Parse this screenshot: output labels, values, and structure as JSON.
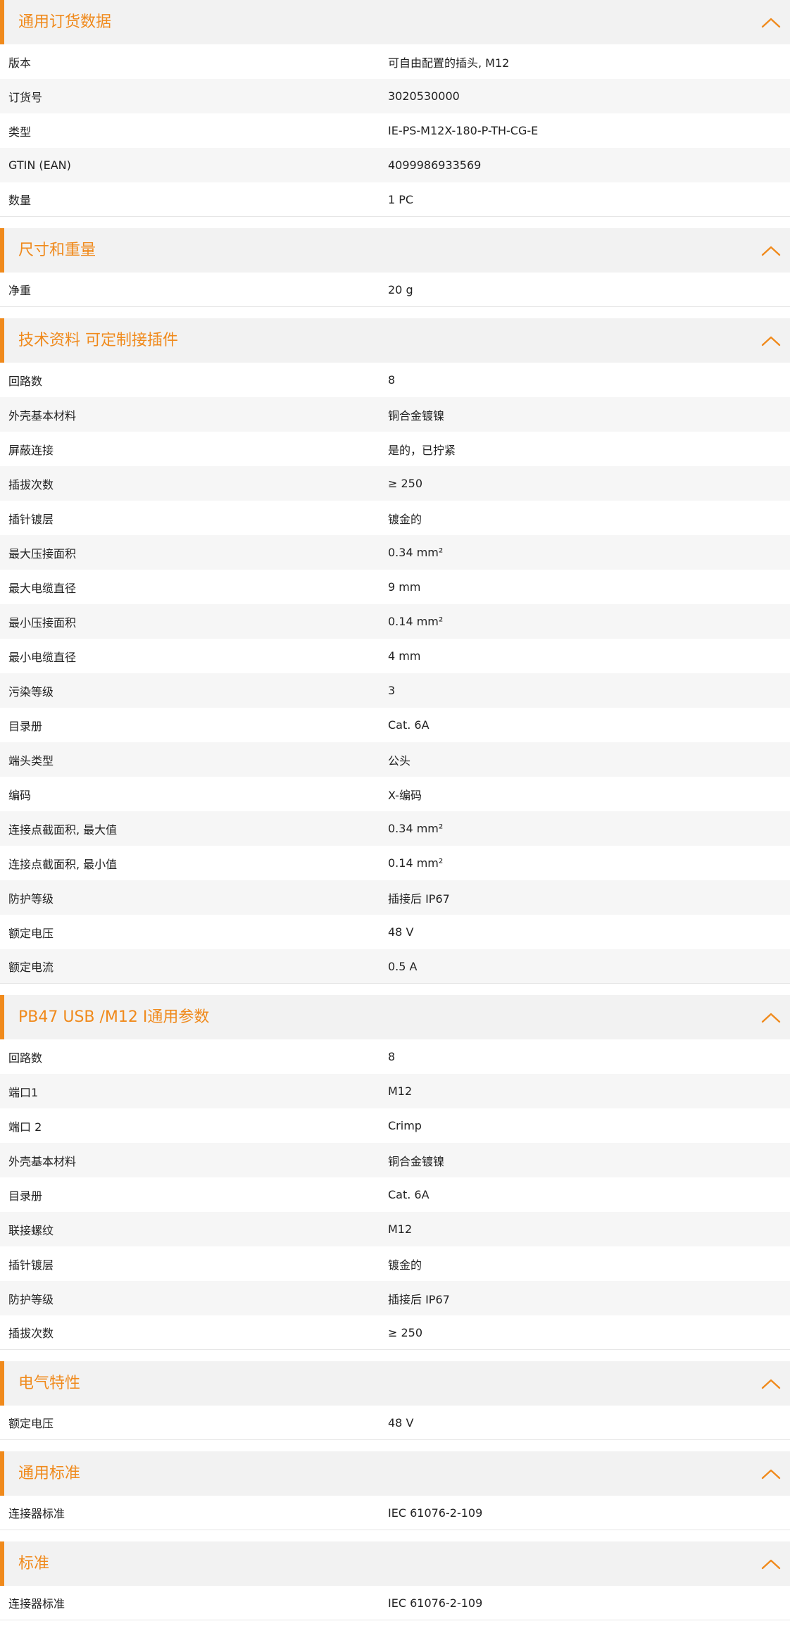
{
  "sections": [
    {
      "title": "通用订货数据",
      "rows": [
        {
          "label": "版本",
          "value": "可自由配置的插头, M12"
        },
        {
          "label": "订货号",
          "value": "3020530000"
        },
        {
          "label": "类型",
          "value": "IE-PS-M12X-180-P-TH-CG-E"
        },
        {
          "label": "GTIN (EAN)",
          "value": "4099986933569"
        },
        {
          "label": "数量",
          "value": "1  PC"
        }
      ]
    },
    {
      "title": "尺寸和重量",
      "rows": [
        {
          "label": "净重",
          "value": "20  g"
        }
      ]
    },
    {
      "title": "技术资料 可定制接插件",
      "rows": [
        {
          "label": "回路数",
          "value": "8"
        },
        {
          "label": "外壳基本材料",
          "value": "铜合金镀镍"
        },
        {
          "label": "屏蔽连接",
          "value": "是的，已拧紧"
        },
        {
          "label": "插拔次数",
          "value": "≥ 250"
        },
        {
          "label": "插针镀层",
          "value": "镀金的"
        },
        {
          "label": "最大压接面积",
          "value": "0.34  mm²"
        },
        {
          "label": "最大电缆直径",
          "value": "9  mm"
        },
        {
          "label": "最小压接面积",
          "value": "0.14  mm²"
        },
        {
          "label": "最小电缆直径",
          "value": "4  mm"
        },
        {
          "label": "污染等级",
          "value": "3"
        },
        {
          "label": "目录册",
          "value": "Cat. 6A"
        },
        {
          "label": "端头类型",
          "value": "公头"
        },
        {
          "label": "编码",
          "value": "X-编码"
        },
        {
          "label": "连接点截面积, 最大值",
          "value": "0.34  mm²"
        },
        {
          "label": "连接点截面积, 最小值",
          "value": "0.14  mm²"
        },
        {
          "label": "防护等级",
          "value": "插接后 IP67"
        },
        {
          "label": "额定电压",
          "value": "48  V"
        },
        {
          "label": "额定电流",
          "value": "0.5  A"
        }
      ]
    },
    {
      "title": "PB47 USB /M12 I通用参数",
      "rows": [
        {
          "label": "回路数",
          "value": "8"
        },
        {
          "label": "端口1",
          "value": "M12"
        },
        {
          "label": "端口 2",
          "value": "Crimp"
        },
        {
          "label": "外壳基本材料",
          "value": "铜合金镀镍"
        },
        {
          "label": "目录册",
          "value": "Cat. 6A"
        },
        {
          "label": "联接螺纹",
          "value": "M12"
        },
        {
          "label": "插针镀层",
          "value": "镀金的"
        },
        {
          "label": "防护等级",
          "value": "插接后 IP67"
        },
        {
          "label": "插拔次数",
          "value": "≥ 250"
        }
      ]
    },
    {
      "title": "电气特性",
      "rows": [
        {
          "label": "额定电压",
          "value": "48  V"
        }
      ]
    },
    {
      "title": "通用标准",
      "rows": [
        {
          "label": "连接器标准",
          "value": "IEC 61076-2-109"
        }
      ]
    },
    {
      "title": "标准",
      "rows": [
        {
          "label": "连接器标准",
          "value": "IEC 61076-2-109"
        }
      ]
    }
  ]
}
